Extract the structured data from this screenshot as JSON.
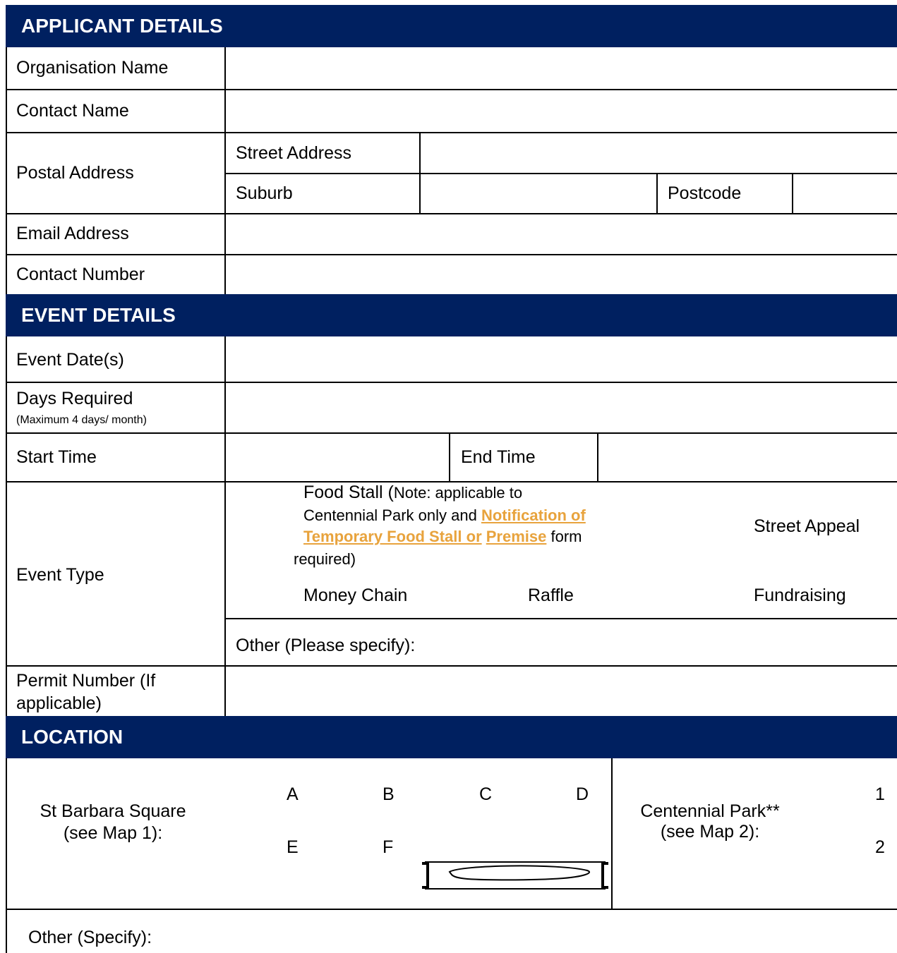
{
  "sections": {
    "applicant": "APPLICANT DETAILS",
    "event": "EVENT DETAILS",
    "location": "LOCATION"
  },
  "applicant": {
    "organisation_name": "Organisation Name",
    "contact_name": "Contact Name",
    "postal_address": "Postal Address",
    "street_address": "Street Address",
    "suburb": "Suburb",
    "postcode": "Postcode",
    "email_address": "Email Address",
    "contact_number": "Contact Number"
  },
  "event": {
    "event_dates": "Event Date(s)",
    "days_required": "Days Required",
    "days_required_note": "(Maximum 4 days/ month)",
    "start_time": "Start Time",
    "end_time": "End Time",
    "event_type": "Event Type",
    "food_stall_title": "Food Stall (",
    "food_stall_note_a": "Note: applicable to",
    "food_stall_note_b": "Centennial Park only and ",
    "food_stall_link_1": "Notification of",
    "food_stall_link_2": "Temporary Food Stall or",
    "food_stall_link_3": "Premise",
    "food_stall_note_c": " form",
    "food_stall_note_d": "required)",
    "street_appeal": "Street Appeal",
    "money_chain": "Money Chain",
    "raffle": "Raffle",
    "fundraising": "Fundraising",
    "other_specify": "Other (Please specify):",
    "permit_number_1": "Permit Number (If",
    "permit_number_2": "applicable)"
  },
  "location": {
    "st_barbara_1": "St Barbara Square",
    "st_barbara_2": "(see Map 1):",
    "options_st_barbara": [
      "A",
      "B",
      "C",
      "D",
      "E",
      "F"
    ],
    "centennial_1": "Centennial Park**",
    "centennial_2": "(see Map 2):",
    "options_centennial": [
      "1",
      "2"
    ],
    "other_specify": "Other (Specify):"
  }
}
